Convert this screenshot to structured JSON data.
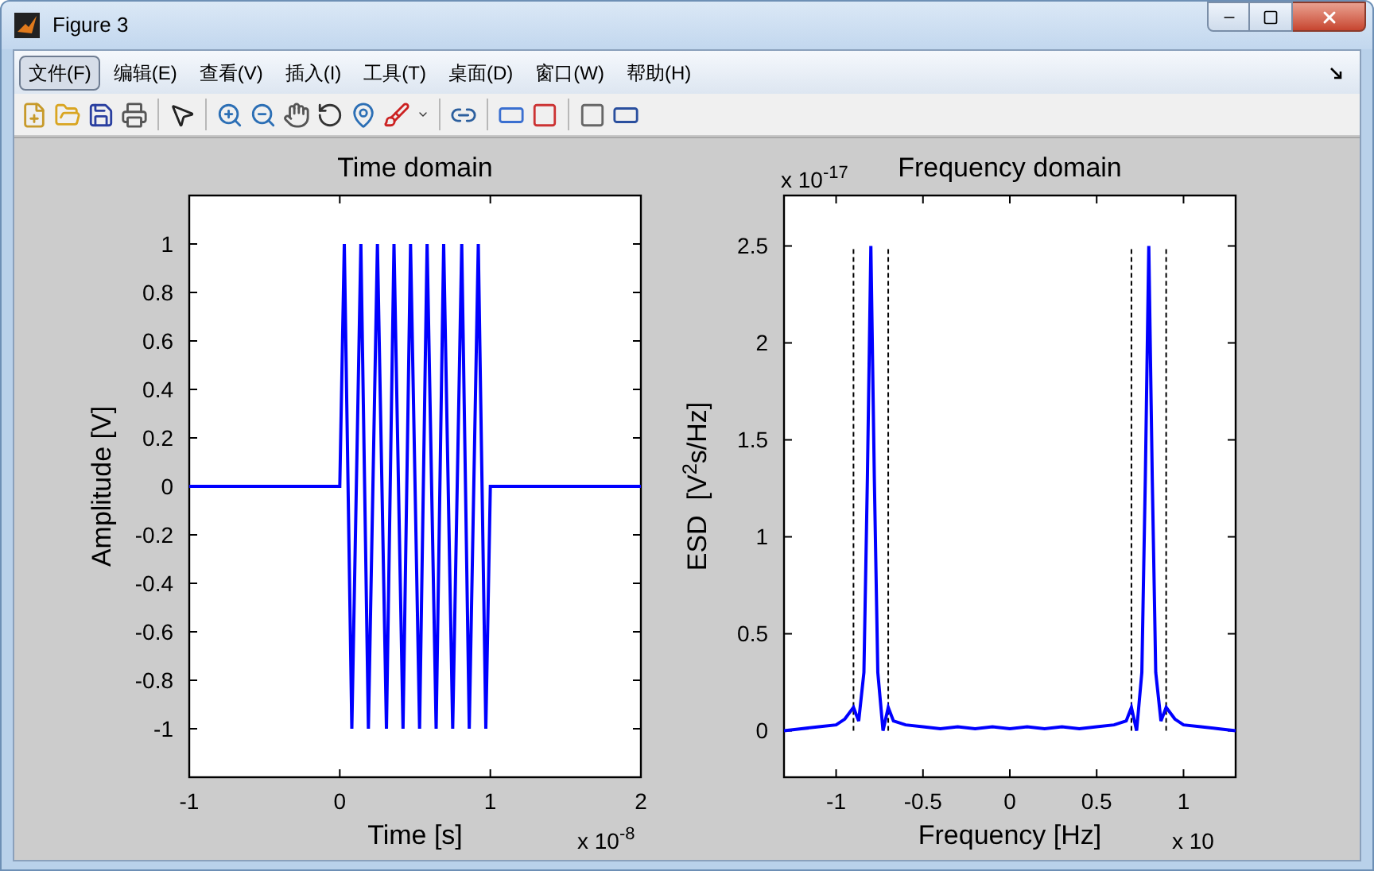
{
  "window": {
    "title": "Figure 3"
  },
  "menu": [
    {
      "label": "文件(F)",
      "selected": true
    },
    {
      "label": "编辑(E)",
      "selected": false
    },
    {
      "label": "查看(V)",
      "selected": false
    },
    {
      "label": "插入(I)",
      "selected": false
    },
    {
      "label": "工具(T)",
      "selected": false
    },
    {
      "label": "桌面(D)",
      "selected": false
    },
    {
      "label": "窗口(W)",
      "selected": false
    },
    {
      "label": "帮助(H)",
      "selected": false
    }
  ],
  "axes": [
    {
      "x_multiplier": "x 10$^{-8}$",
      "chart_data": {
        "type": "line",
        "title": "Time domain",
        "xlabel": "Time [s]",
        "ylabel": "Amplitude [V]",
        "xlim": [
          -1,
          2
        ],
        "ylim": [
          -1.2,
          1.2
        ],
        "xticks": [
          -1,
          0,
          1,
          2
        ],
        "yticks": [
          -1,
          -0.8,
          -0.6,
          -0.4,
          -0.2,
          0,
          0.2,
          0.4,
          0.6,
          0.8,
          1
        ],
        "x": [
          -1,
          0,
          0.03,
          0.08,
          0.14,
          0.19,
          0.25,
          0.31,
          0.36,
          0.42,
          0.47,
          0.53,
          0.58,
          0.64,
          0.69,
          0.75,
          0.81,
          0.86,
          0.92,
          0.97,
          1,
          2
        ],
        "series": [
          {
            "color": "#0000ff",
            "values": [
              0,
              0,
              1,
              -1,
              1,
              -1,
              1,
              -1,
              1,
              -1,
              1,
              -1,
              1,
              -1,
              1,
              -1,
              1,
              -1,
              1,
              -1,
              0,
              0
            ]
          }
        ]
      }
    },
    {
      "y_multiplier": "x 10$^{-17}$",
      "x_multiplier": "x 10",
      "chart_data": {
        "type": "line",
        "title": "Frequency domain",
        "xlabel": "Frequency [Hz]",
        "ylabel": "ESD  [V$^{2}$s/Hz]",
        "xlim": [
          -1.3,
          1.3
        ],
        "ylim": [
          -0.24,
          2.76
        ],
        "xticks": [
          -1,
          -0.5,
          0,
          0.5,
          1
        ],
        "yticks": [
          0,
          0.5,
          1,
          1.5,
          2,
          2.5
        ],
        "x": [
          -1.3,
          -1.2,
          -1.1,
          -1.0,
          -0.95,
          -0.9,
          -0.87,
          -0.84,
          -0.82,
          -0.8,
          -0.78,
          -0.76,
          -0.73,
          -0.7,
          -0.67,
          -0.6,
          -0.5,
          -0.4,
          -0.3,
          -0.2,
          -0.1,
          0,
          0.1,
          0.2,
          0.3,
          0.4,
          0.5,
          0.6,
          0.67,
          0.7,
          0.73,
          0.76,
          0.78,
          0.8,
          0.82,
          0.84,
          0.87,
          0.9,
          0.95,
          1.0,
          1.1,
          1.2,
          1.3
        ],
        "series": [
          {
            "color": "#0000ff",
            "values": [
              0,
              0.01,
              0.02,
              0.03,
              0.06,
              0.12,
              0.05,
              0.3,
              1.3,
              2.5,
              1.3,
              0.3,
              0,
              0.12,
              0.05,
              0.03,
              0.02,
              0.01,
              0.02,
              0.01,
              0.02,
              0.01,
              0.02,
              0.01,
              0.02,
              0.01,
              0.02,
              0.03,
              0.05,
              0.12,
              0,
              0.3,
              1.3,
              2.5,
              1.3,
              0.3,
              0.05,
              0.12,
              0.06,
              0.03,
              0.02,
              0.01,
              0
            ]
          }
        ],
        "ref_lines": [
          {
            "axis": "x",
            "value": -0.9
          },
          {
            "axis": "x",
            "value": -0.7
          },
          {
            "axis": "x",
            "value": 0.7
          },
          {
            "axis": "x",
            "value": 0.9
          }
        ]
      }
    }
  ]
}
